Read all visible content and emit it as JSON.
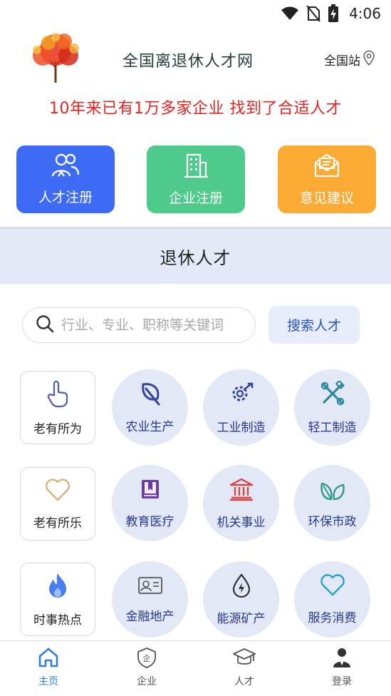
{
  "status_bar": {
    "time": "4:06",
    "icons": [
      "wifi-icon",
      "no-sim-icon",
      "battery-charging-icon"
    ]
  },
  "header": {
    "logo": "tree-logo",
    "title": "全国离退休人才网",
    "site_label": "全国站",
    "site_icon": "location-pin-icon"
  },
  "slogan": "10年来已有1万多家企业 找到了合适人才",
  "quick_actions": [
    {
      "label": "人才注册",
      "icon": "people-icon",
      "color": "#3d6bf5"
    },
    {
      "label": "企业注册",
      "icon": "building-icon",
      "color": "#4ecb8a"
    },
    {
      "label": "意见建议",
      "icon": "envelope-icon",
      "color": "#fbaa34"
    }
  ],
  "section_title": "退休人才",
  "search": {
    "placeholder": "行业、专业、职称等关键词",
    "button_label": "搜索人才"
  },
  "categories": {
    "row1": [
      {
        "label": "老有所为",
        "icon": "hand-pointer-icon",
        "style": "square"
      },
      {
        "label": "农业生产",
        "icon": "leaf-icon",
        "style": "circle"
      },
      {
        "label": "工业制造",
        "icon": "gear-wrench-icon",
        "style": "circle"
      },
      {
        "label": "轻工制造",
        "icon": "tools-icon",
        "style": "circle"
      }
    ],
    "row2": [
      {
        "label": "老有所乐",
        "icon": "heart-outline-icon",
        "style": "square"
      },
      {
        "label": "教育医疗",
        "icon": "book-icon",
        "style": "circle"
      },
      {
        "label": "机关事业",
        "icon": "government-building-icon",
        "style": "circle"
      },
      {
        "label": "环保市政",
        "icon": "plant-icon",
        "style": "circle"
      }
    ],
    "row3": [
      {
        "label": "时事热点",
        "icon": "flame-icon",
        "style": "square"
      },
      {
        "label": "金融地产",
        "icon": "id-card-icon",
        "style": "circle"
      },
      {
        "label": "能源矿产",
        "icon": "energy-drop-icon",
        "style": "circle"
      },
      {
        "label": "服务消费",
        "icon": "heart-icon",
        "style": "circle"
      }
    ]
  },
  "tab_bar": [
    {
      "label": "主页",
      "icon": "home-icon",
      "active": true
    },
    {
      "label": "企业",
      "icon": "enterprise-shield-icon",
      "active": false
    },
    {
      "label": "人才",
      "icon": "graduation-cap-icon",
      "active": false
    },
    {
      "label": "登录",
      "icon": "user-icon",
      "active": false
    }
  ],
  "colors": {
    "accent_blue": "#3d6bf5",
    "slogan_red": "#e6231f",
    "tab_active": "#2f7fe0",
    "category_circle": "#e3e8f7"
  }
}
